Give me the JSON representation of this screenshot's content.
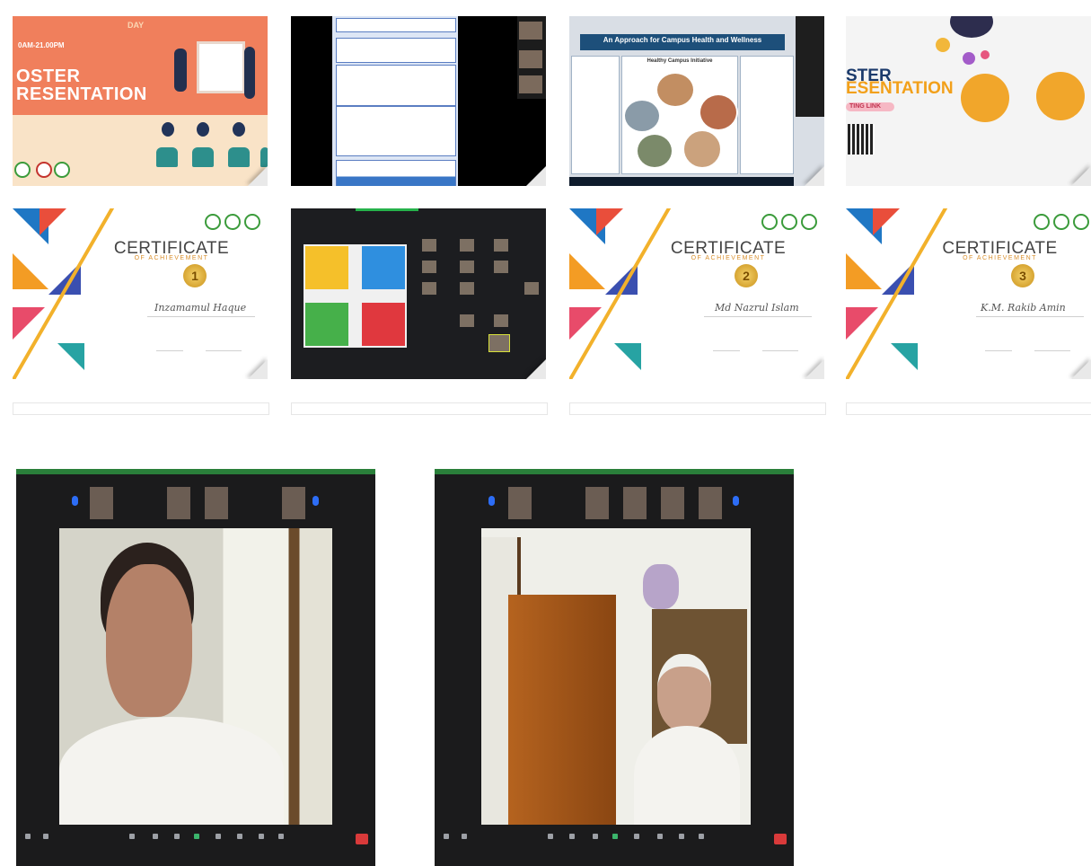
{
  "gallery": {
    "tile1": {
      "title_line1": "OSTER",
      "title_line2": "RESENTATION",
      "subtitle": "0AM-21.00PM",
      "day_label": "DAY"
    },
    "tile4": {
      "title_line1": "STER",
      "title_line2": "ESENTATION",
      "link_label": "TING LINK"
    },
    "tile3": {
      "headline": "An Approach for Campus Health and Wellness",
      "subhead": "Healthy Campus Initiative"
    },
    "certificates": [
      {
        "title": "CERTIFICATE",
        "subtitle": "OF ACHIEVEMENT",
        "recipient": "Inzamamul Haque",
        "place": "1"
      },
      {
        "title": "CERTIFICATE",
        "subtitle": "OF ACHIEVEMENT",
        "recipient": "Md Nazrul Islam",
        "place": "2"
      },
      {
        "title": "CERTIFICATE",
        "subtitle": "OF ACHIEVEMENT",
        "recipient": "K.M. Rakib Amin",
        "place": "3"
      }
    ]
  },
  "colors": {
    "poster_orange": "#f07f5c",
    "zoom_green": "#2a7f3a",
    "cert_gold": "#f2b12b"
  }
}
